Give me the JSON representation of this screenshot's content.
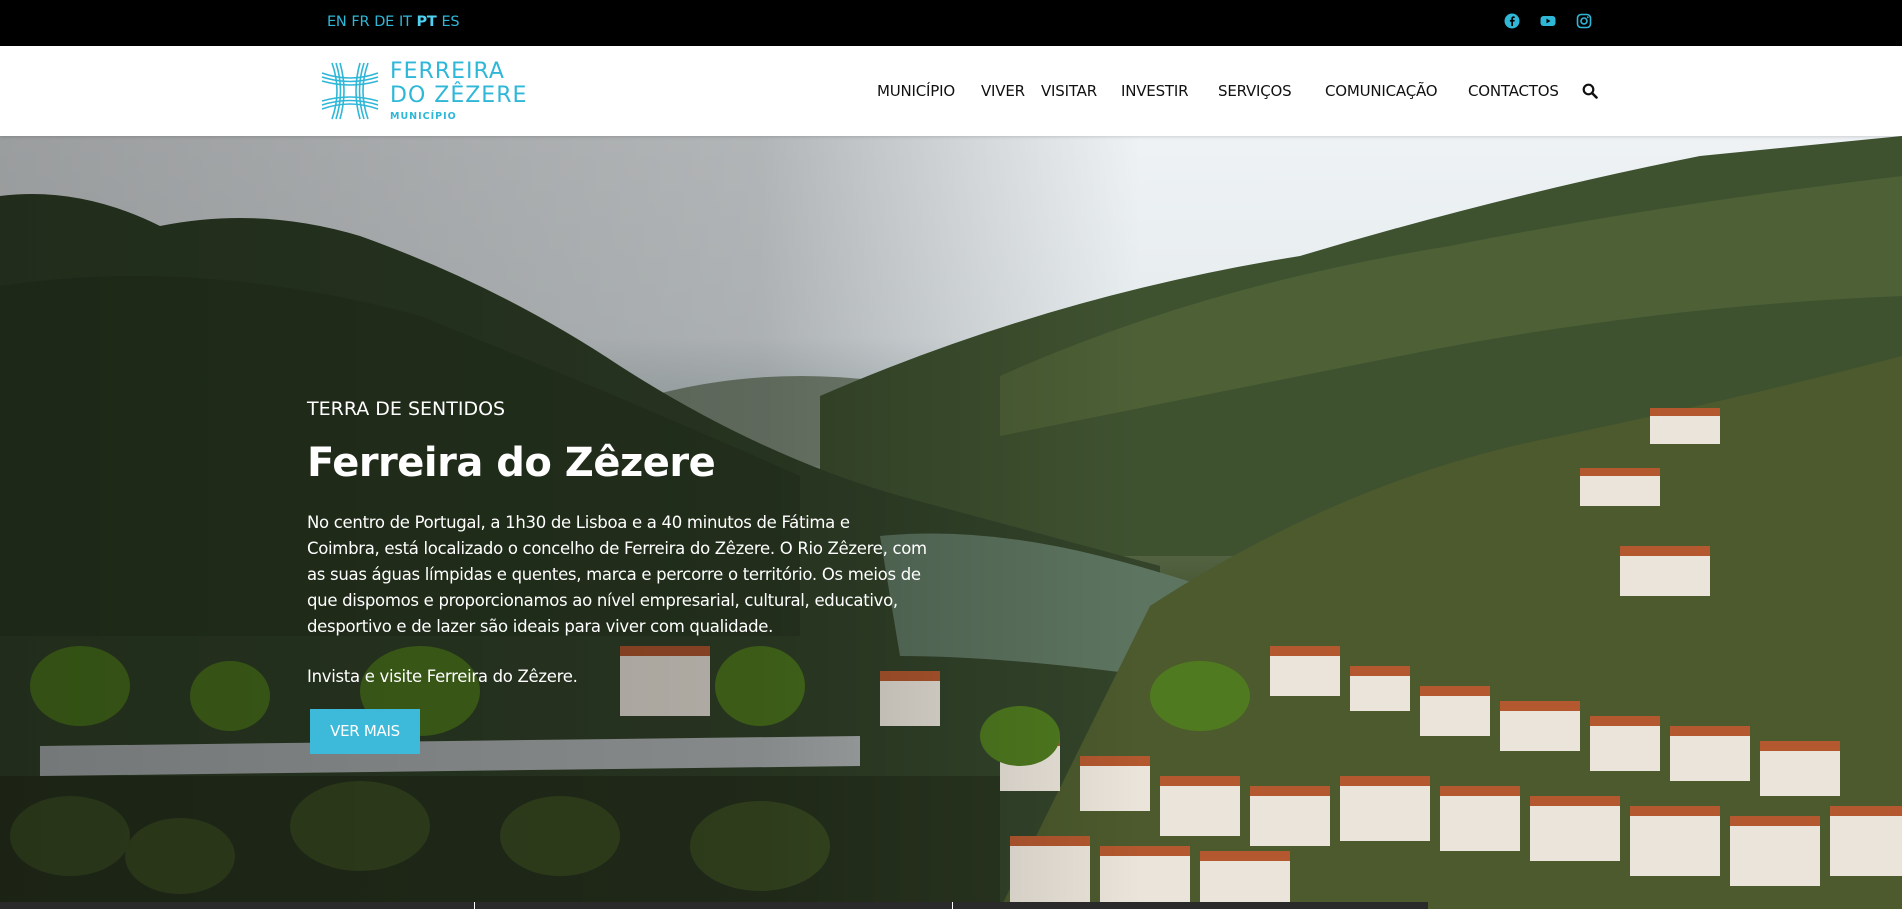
{
  "languages": [
    {
      "code": "EN",
      "active": false
    },
    {
      "code": "FR",
      "active": false
    },
    {
      "code": "DE",
      "active": false
    },
    {
      "code": "IT",
      "active": false
    },
    {
      "code": "PT",
      "active": true
    },
    {
      "code": "ES",
      "active": false
    }
  ],
  "social": [
    "facebook-icon",
    "youtube-icon",
    "instagram-icon"
  ],
  "logo": {
    "line1": "FERREIRA",
    "line2": "DO ZÊZERE",
    "line3": "MUNICÍPIO"
  },
  "nav": {
    "items": [
      "MUNICÍPIO",
      "VIVER",
      "VISITAR",
      "INVESTIR",
      "SERVIÇOS",
      "COMUNICAÇÃO",
      "CONTACTOS"
    ]
  },
  "hero": {
    "kicker": "TERRA DE SENTIDOS",
    "title": "Ferreira do Zêzere",
    "description": "No centro de Portugal, a 1h30 de Lisboa e a 40 minutos de Fátima e Coimbra, está localizado o concelho de Ferreira do Zêzere. O Rio Zêzere, com as suas águas límpidas e quentes, marca e percorre o território. Os meios de que dispomos e proporcionamos ao nível empresarial, cultural, educativo, desportivo e de lazer são ideais para viver com qualidade.",
    "cta_text": "Invista e visite Ferreira do Zêzere.",
    "button_label": "VER MAIS"
  },
  "colors": {
    "accent": "#3db9da",
    "topbar": "#000000",
    "header": "#ffffff"
  }
}
